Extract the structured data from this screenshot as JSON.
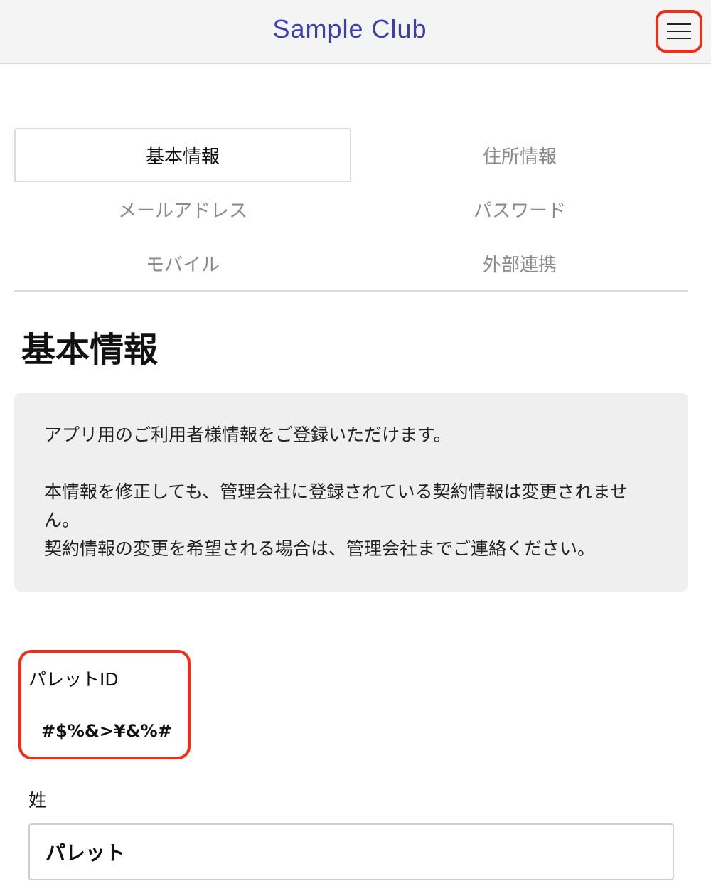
{
  "header": {
    "title": "Sample Club",
    "menu_icon": "hamburger-icon"
  },
  "tabs": [
    {
      "label": "基本情報",
      "active": true
    },
    {
      "label": "住所情報",
      "active": false
    },
    {
      "label": "メールアドレス",
      "active": false
    },
    {
      "label": "パスワード",
      "active": false
    },
    {
      "label": "モバイル",
      "active": false
    },
    {
      "label": "外部連携",
      "active": false
    }
  ],
  "main": {
    "title": "基本情報",
    "info": {
      "line1": "アプリ用のご利用者様情報をご登録いただけます。",
      "line2": "本情報を修正しても、管理会社に登録されている契約情報は変更されません。",
      "line3": "契約情報の変更を希望される場合は、管理会社までご連絡ください。"
    },
    "palette_id": {
      "label": "パレットID",
      "value": "#$%&>¥&%#"
    },
    "last_name": {
      "label": "姓",
      "value": "パレット"
    }
  },
  "colors": {
    "accent": "#3f3fa8",
    "highlight": "#ee2d1a",
    "info_bg": "#efefef"
  }
}
